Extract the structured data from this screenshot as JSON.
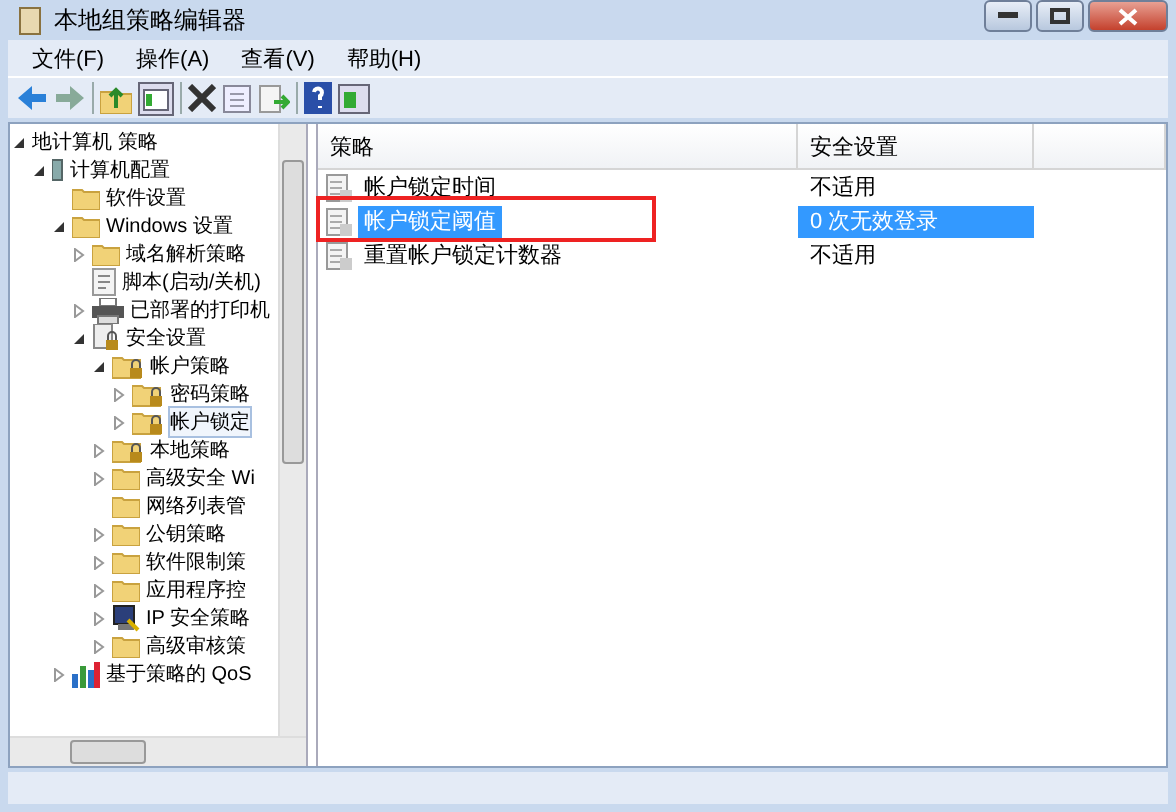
{
  "window": {
    "title": "本地组策略编辑器"
  },
  "menu": [
    {
      "label": "文件(F)"
    },
    {
      "label": "操作(A)"
    },
    {
      "label": "查看(V)"
    },
    {
      "label": "帮助(H)"
    }
  ],
  "tree": {
    "items": [
      {
        "label": "地计算机 策略",
        "expanded": true,
        "children": [
          {
            "label": "计算机配置",
            "kind": "computer",
            "expanded": true,
            "children": [
              {
                "label": "软件设置",
                "kind": "folder"
              },
              {
                "label": "Windows 设置",
                "kind": "folder",
                "expanded": true,
                "children": [
                  {
                    "label": "域名解析策略",
                    "kind": "folder",
                    "expanded": false
                  },
                  {
                    "label": "脚本(启动/关机)",
                    "kind": "script"
                  },
                  {
                    "label": "已部署的打印机",
                    "kind": "printer",
                    "expanded": false
                  },
                  {
                    "label": "安全设置",
                    "kind": "lock",
                    "expanded": true,
                    "children": [
                      {
                        "label": "帐户策略",
                        "kind": "lockfolder",
                        "expanded": true,
                        "children": [
                          {
                            "label": "密码策略",
                            "kind": "lockfolder",
                            "expanded": false,
                            "selected": false
                          },
                          {
                            "label": "帐户锁定",
                            "kind": "lockfolder",
                            "expanded": false,
                            "selected": true
                          }
                        ]
                      },
                      {
                        "label": "本地策略",
                        "kind": "lockfolder",
                        "expanded": false
                      },
                      {
                        "label": "高级安全 Wi",
                        "kind": "folder",
                        "expanded": false
                      },
                      {
                        "label": "网络列表管",
                        "kind": "folder"
                      },
                      {
                        "label": "公钥策略",
                        "kind": "folder",
                        "expanded": false
                      },
                      {
                        "label": "软件限制策",
                        "kind": "folder",
                        "expanded": false
                      },
                      {
                        "label": "应用程序控",
                        "kind": "folder",
                        "expanded": false
                      },
                      {
                        "label": "IP 安全策略",
                        "kind": "shield",
                        "expanded": false
                      },
                      {
                        "label": "高级审核策",
                        "kind": "folder",
                        "expanded": false
                      }
                    ]
                  }
                ]
              },
              {
                "label": "基于策略的 QoS",
                "kind": "chart",
                "expanded": false
              }
            ]
          }
        ]
      }
    ]
  },
  "table": {
    "columns": [
      {
        "label": "策略"
      },
      {
        "label": "安全设置"
      }
    ],
    "rows": [
      {
        "name": "帐户锁定时间",
        "setting": "不适用",
        "selected": false,
        "annotated": false
      },
      {
        "name": "帐户锁定阈值",
        "setting": "0 次无效登录",
        "selected": true,
        "annotated": true
      },
      {
        "name": "重置帐户锁定计数器",
        "setting": "不适用",
        "selected": false,
        "annotated": false
      }
    ]
  }
}
